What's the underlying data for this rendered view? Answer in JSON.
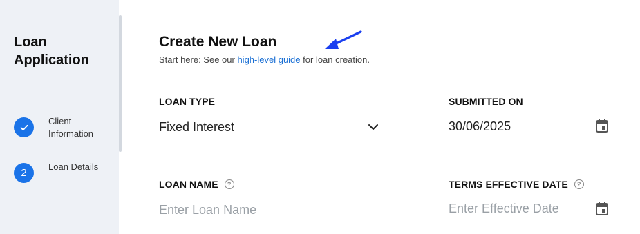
{
  "sidebar": {
    "title": "Loan Application",
    "steps": [
      {
        "label": "Client Information",
        "state": "complete",
        "icon": "checkmark-icon"
      },
      {
        "label": "Loan Details",
        "state": "current",
        "number": "2"
      }
    ]
  },
  "main": {
    "title": "Create New Loan",
    "subtitle_prefix": "Start here: See our ",
    "subtitle_link": "high-level guide",
    "subtitle_suffix": " for loan creation.",
    "fields": {
      "loan_type": {
        "label": "LOAN TYPE",
        "value": "Fixed Interest"
      },
      "submitted_on": {
        "label": "SUBMITTED ON",
        "value": "30/06/2025"
      },
      "loan_name": {
        "label": "LOAN NAME",
        "placeholder": "Enter Loan Name"
      },
      "terms_effective_date": {
        "label": "TERMS EFFECTIVE DATE",
        "placeholder": "Enter Effective Date"
      }
    }
  },
  "colors": {
    "accent": "#1a73e8",
    "link": "#1a6fd4",
    "sidebar_bg": "#eef1f6",
    "arrow": "#1a3ff0"
  }
}
